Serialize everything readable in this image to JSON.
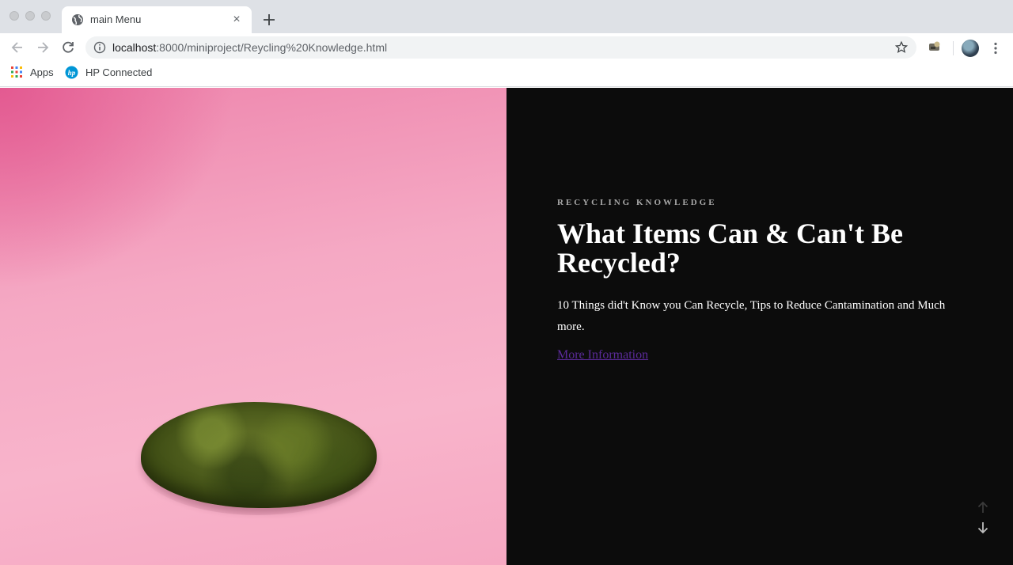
{
  "browser": {
    "tab_title": "main Menu",
    "tab_close_glyph": "×",
    "url_host": "localhost",
    "url_path": ":8000/miniproject/Reycling%20Knowledge.html",
    "bookmarks": [
      {
        "label": "Apps",
        "icon": "apps-grid-icon"
      },
      {
        "label": "HP Connected",
        "icon": "hp-logo-icon"
      }
    ]
  },
  "page": {
    "kicker": "RECYCLING KNOWLEDGE",
    "headline": "What Items Can & Can't Be Recycled?",
    "lede": "10 Things did't Know you Can Recycle, Tips to Reduce Cantamination and Much more.",
    "link_text": "More Information"
  },
  "colors": {
    "panel_bg": "#0c0c0c",
    "hero_pink": "#f5a9c4",
    "link": "#5b2b9a"
  }
}
